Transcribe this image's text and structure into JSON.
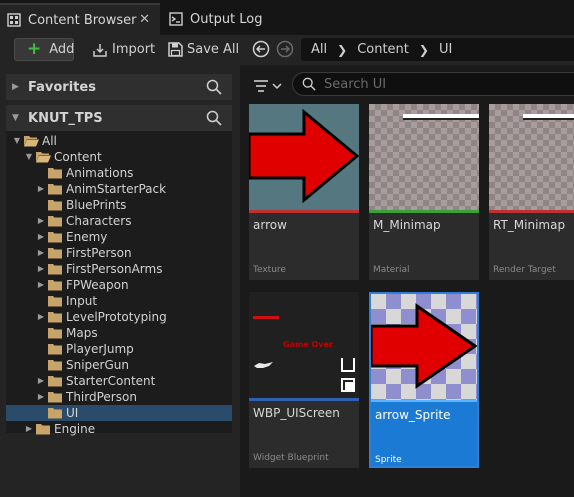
{
  "tabs": [
    {
      "label": "Content Browser",
      "icon": "content-browser-icon"
    },
    {
      "label": "Output Log",
      "icon": "output-log-icon"
    }
  ],
  "tab_close": "✕",
  "toolbar": {
    "add_label": "Add",
    "import_label": "Import",
    "saveall_label": "Save All"
  },
  "breadcrumb": [
    "All",
    "Content",
    "UI"
  ],
  "favorites_label": "Favorites",
  "project_label": "KNUT_TPS",
  "tree": [
    {
      "label": "All",
      "depth": 0,
      "expanded": true,
      "has_children": true
    },
    {
      "label": "Content",
      "depth": 1,
      "expanded": true,
      "has_children": true
    },
    {
      "label": "Animations",
      "depth": 2,
      "has_children": false
    },
    {
      "label": "AnimStarterPack",
      "depth": 2,
      "has_children": true
    },
    {
      "label": "BluePrints",
      "depth": 2,
      "has_children": false
    },
    {
      "label": "Characters",
      "depth": 2,
      "has_children": true
    },
    {
      "label": "Enemy",
      "depth": 2,
      "has_children": true
    },
    {
      "label": "FirstPerson",
      "depth": 2,
      "has_children": true
    },
    {
      "label": "FirstPersonArms",
      "depth": 2,
      "has_children": true
    },
    {
      "label": "FPWeapon",
      "depth": 2,
      "has_children": true
    },
    {
      "label": "Input",
      "depth": 2,
      "has_children": false
    },
    {
      "label": "LevelPrototyping",
      "depth": 2,
      "has_children": true
    },
    {
      "label": "Maps",
      "depth": 2,
      "has_children": false
    },
    {
      "label": "PlayerJump",
      "depth": 2,
      "has_children": false
    },
    {
      "label": "SniperGun",
      "depth": 2,
      "has_children": false
    },
    {
      "label": "StarterContent",
      "depth": 2,
      "has_children": true
    },
    {
      "label": "ThirdPerson",
      "depth": 2,
      "has_children": true
    },
    {
      "label": "UI",
      "depth": 2,
      "has_children": false,
      "selected": true
    },
    {
      "label": "Engine",
      "depth": 1,
      "has_children": true
    }
  ],
  "search": {
    "placeholder": "Search UI"
  },
  "assets": [
    {
      "name": "arrow",
      "type": "Texture",
      "color": "#c03030"
    },
    {
      "name": "M_Minimap",
      "type": "Material",
      "color": "#3aa03a"
    },
    {
      "name": "RT_Minimap",
      "type": "Render Target",
      "color": "#c03030"
    },
    {
      "name": "WBP_UIScreen",
      "type": "Widget Blueprint",
      "color": "#2f5fb0",
      "thumb_text": "Game Over"
    },
    {
      "name": "arrow_Sprite",
      "type": "Sprite",
      "color": "#5ab4ff"
    }
  ],
  "colors": {
    "selection": "#2a4c6a",
    "accent_blue": "#1b7ad3",
    "add_green": "#3ec23e",
    "folder": "#c8a46a"
  }
}
